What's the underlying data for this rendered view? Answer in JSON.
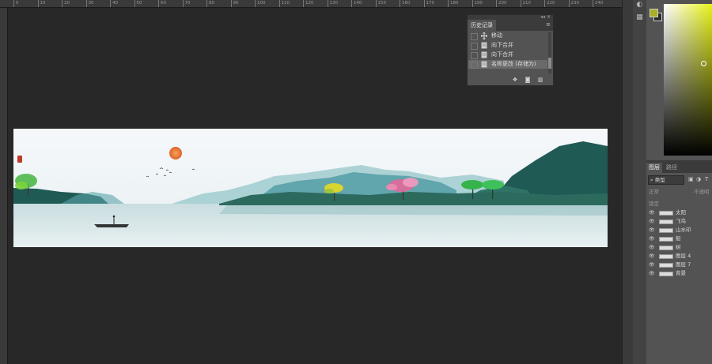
{
  "ruler": {
    "labels": [
      "0",
      "10",
      "20",
      "30",
      "40",
      "50",
      "60",
      "70",
      "80",
      "90",
      "100",
      "110",
      "120",
      "130",
      "140",
      "150",
      "160",
      "170",
      "180",
      "190",
      "200",
      "210",
      "220",
      "230",
      "240"
    ]
  },
  "history_panel": {
    "tab_label": "历史记录",
    "items": [
      {
        "label": "移动",
        "icon": "move-icon"
      },
      {
        "label": "向下合并",
        "icon": "document-icon"
      },
      {
        "label": "向下合并",
        "icon": "document-icon"
      },
      {
        "label": "名称更改 (存储为)",
        "icon": "document-icon"
      }
    ],
    "footer_icons": [
      "new-document-from-state-icon",
      "snapshot-camera-icon",
      "trash-icon"
    ]
  },
  "layers_panel": {
    "tab_active": "图层",
    "tab_inactive": "路径",
    "filter_label": "类型",
    "blend_mode": "正常",
    "opacity_label": "不透明",
    "lock_label": "锁定",
    "layers": [
      {
        "name": "太阳"
      },
      {
        "name": "飞鸟"
      },
      {
        "name": "山水印"
      },
      {
        "name": "船"
      },
      {
        "name": "树"
      },
      {
        "name": "图层 4"
      },
      {
        "name": "图层 7"
      },
      {
        "name": "背景"
      }
    ]
  },
  "colors": {
    "foreground": "#a9ae24",
    "background": "#2e2e2e",
    "hue": "#e7f21a"
  }
}
